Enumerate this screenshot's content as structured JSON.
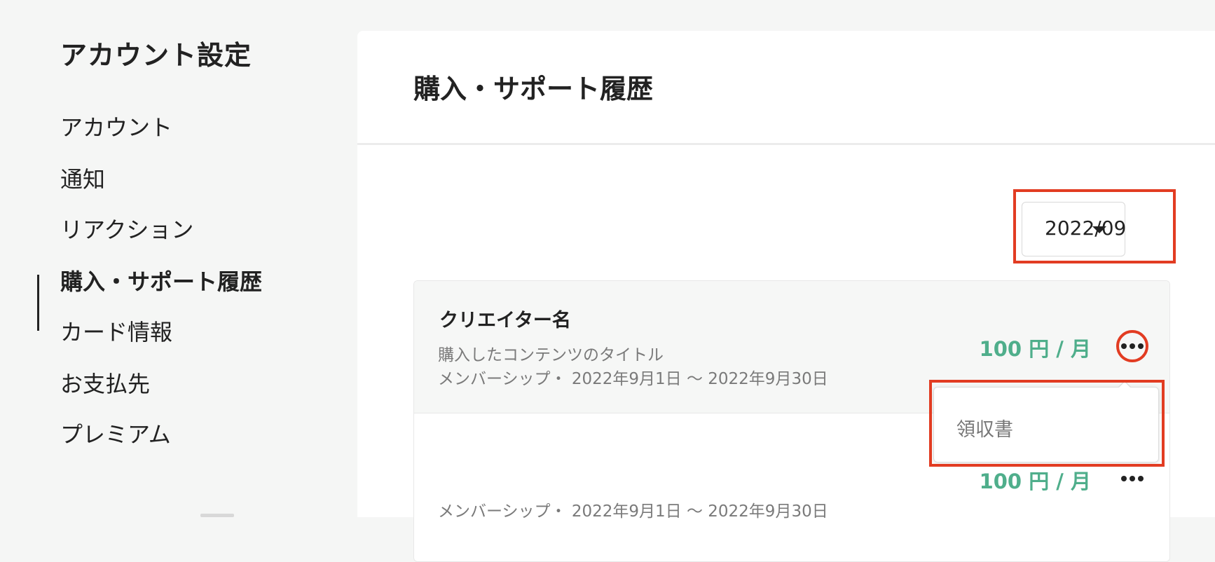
{
  "sidebar": {
    "title": "アカウント設定",
    "items": [
      {
        "label": "アカウント",
        "active": false
      },
      {
        "label": "通知",
        "active": false
      },
      {
        "label": "リアクション",
        "active": false
      },
      {
        "label": "購入・サポート履歴",
        "active": true
      },
      {
        "label": "カード情報",
        "active": false
      },
      {
        "label": "お支払先",
        "active": false
      },
      {
        "label": "プレミアム",
        "active": false
      }
    ]
  },
  "main": {
    "title": "購入・サポート履歴",
    "month_select": {
      "value": "2022/09"
    },
    "purchases": [
      {
        "creator": "クリエイター名",
        "content_title": "購入したコンテンツのタイトル",
        "period": "メンバーシップ・ 2022年9月1日 〜 2022年9月30日",
        "price": "100 円 / 月"
      },
      {
        "creator": "",
        "content_title": "",
        "period": "メンバーシップ・ 2022年9月1日 〜 2022年9月30日",
        "price": "100 円 / 月"
      }
    ],
    "more_menu": {
      "items": [
        {
          "label": "領収書"
        }
      ]
    }
  },
  "colors": {
    "accent_green": "#4fae8b",
    "highlight_red": "#e23c22",
    "background": "#f5f6f5"
  },
  "icons": {
    "select_caret": "caret-down-icon",
    "more": "more-horizontal-icon"
  }
}
